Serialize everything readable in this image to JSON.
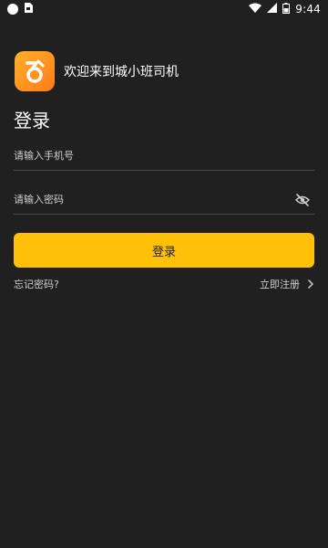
{
  "status_bar": {
    "time": "9:44",
    "icons": [
      "circle-icon",
      "sim-card-icon",
      "wifi-icon",
      "signal-icon",
      "battery-icon"
    ]
  },
  "header": {
    "welcome_text": "欢迎来到城小班司机",
    "logo_icon": "app-logo-icon"
  },
  "page": {
    "title": "登录"
  },
  "form": {
    "phone_placeholder": "请输入手机号",
    "password_placeholder": "请输入密码",
    "password_toggle_icon": "eye-off-icon",
    "login_label": "登录"
  },
  "links": {
    "forgot_password": "忘记密码?",
    "register": "立即注册"
  },
  "colors": {
    "background": "#202020",
    "accent": "#ffc107",
    "logo_gradient_start": "#ffb12a",
    "logo_gradient_end": "#ff7b1a"
  }
}
